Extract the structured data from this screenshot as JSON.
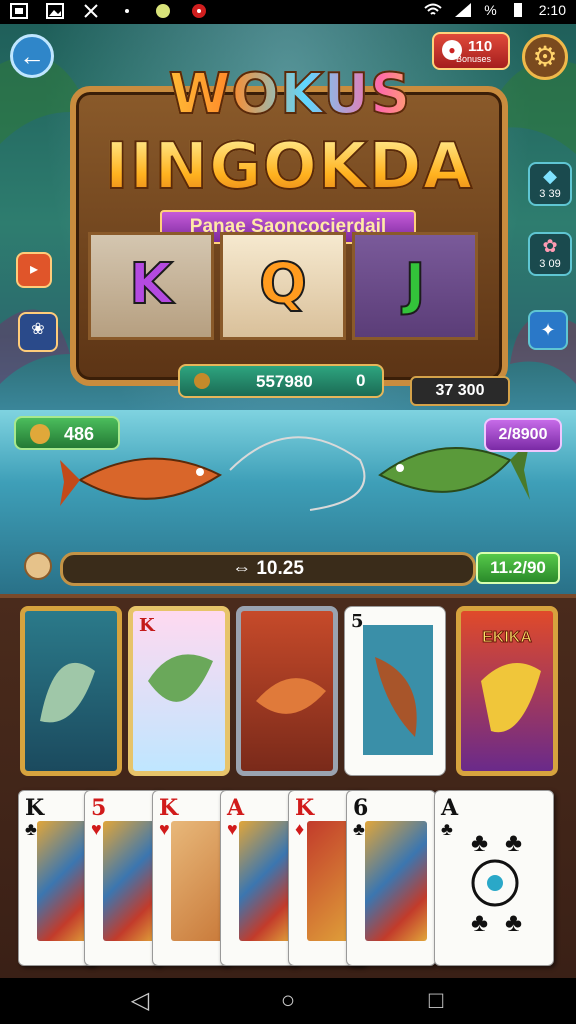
{
  "status_bar": {
    "right_percent": "%",
    "time": "2:10"
  },
  "header": {
    "counter_value": "110",
    "counter_sub": "Bonuses",
    "title_line1": "WOKUS",
    "title_line2": "IINGOKDA",
    "ribbon_text": "Panae Saoncocjerdail"
  },
  "reels": [
    "K",
    "Q",
    "J"
  ],
  "balance": {
    "main_value": "557980",
    "main_suffix": "0",
    "right_value": "37 300"
  },
  "side_right": [
    {
      "label": "3 39"
    },
    {
      "label": "3 09"
    }
  ],
  "pills": {
    "green_value": "486",
    "purple_value": "2/8900",
    "info_value": "10.25",
    "info_prefix": "⇔",
    "right_green": "11.2/90"
  },
  "fish_cards": [
    {
      "corner": "",
      "label": ""
    },
    {
      "corner": "K",
      "label": ""
    },
    {
      "corner": "",
      "label": ""
    },
    {
      "corner": "5",
      "label": ""
    },
    {
      "corner": "",
      "label": "EKIKA"
    }
  ],
  "playing_cards": [
    {
      "rank": "K",
      "suit": "♣",
      "color": "blk"
    },
    {
      "rank": "5",
      "suit": "♥",
      "color": "red"
    },
    {
      "rank": "K",
      "suit": "♥",
      "color": "red"
    },
    {
      "rank": "A",
      "suit": "♥",
      "color": "red"
    },
    {
      "rank": "K",
      "suit": "♦",
      "color": "red"
    },
    {
      "rank": "6",
      "suit": "♣",
      "color": "blk"
    },
    {
      "rank": "A",
      "suit": "♣",
      "color": "blk"
    }
  ],
  "colors": {
    "accent_gold": "#d6a33e",
    "water": "#3e9fb8",
    "table": "#4a2b1c"
  }
}
